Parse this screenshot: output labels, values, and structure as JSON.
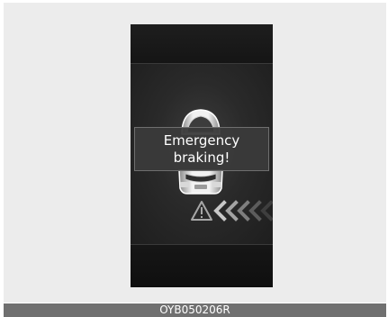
{
  "display": {
    "message_line1": "Emergency",
    "message_line2": "braking!",
    "icons": {
      "vehicle": "front-car-icon",
      "warning": "warning-triangle-icon",
      "approach": "approach-chevrons-icon"
    },
    "colors": {
      "background": "#141414",
      "message_box": "#3a3a3a",
      "text": "#ffffff"
    }
  },
  "caption": {
    "code": "OYB050206R"
  }
}
